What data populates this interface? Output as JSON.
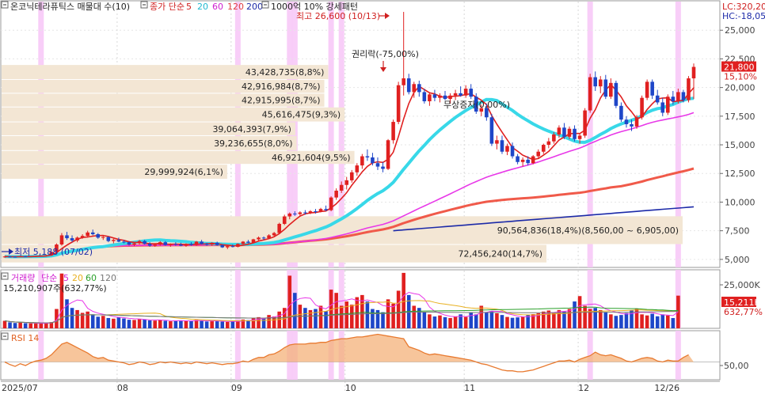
{
  "price_panel": {
    "title": "온코닉테라퓨틱스 매물대 수(10)",
    "ma_prefix": "종가 단순",
    "ma_periods": [
      "5",
      "20",
      "60",
      "120",
      "200"
    ],
    "ma_colors": [
      "#e02020",
      "#38d8e8",
      "#e838e8",
      "#f05a4a",
      "#1c2aa8"
    ],
    "pattern_label": "1000억 10% 강세패턴",
    "lc_label": "LC:320,20",
    "hc_label": "HC:-18,05",
    "high_label": "최고 26,600 (10/13)",
    "low_label": "최저 5,188 (07/02)",
    "rights_label": "권리락(-75,00%)",
    "bonus_label": "무상증자(0,00%)",
    "current_price": "21,800",
    "current_change": "15,10%",
    "y_ticks": [
      "25,000",
      "22,500",
      "20,000",
      "17,500",
      "15,000",
      "12,500",
      "10,000",
      "7,500",
      "5,000"
    ]
  },
  "volume_panel": {
    "title": "거래량",
    "ma_prefix": "단순",
    "ma_periods": [
      "5",
      "20",
      "60",
      "120"
    ],
    "ma_colors": [
      "#e838e8",
      "#e8b020",
      "#2aa02a",
      "#777777"
    ],
    "current_value": "15,210,907주(632,77%)",
    "axis_label": "25,000K",
    "tag_value": "15,211K",
    "tag_pct": "632,77%"
  },
  "rsi_panel": {
    "title": "RSI 14",
    "axis_label": "50,00"
  },
  "x_axis": {
    "labels": [
      "2025/07",
      "08",
      "09",
      "10",
      "11",
      "12",
      "12/26"
    ]
  },
  "chart_data": {
    "type": "candlestick",
    "title": "온코닉테라퓨틱스 매물대 수(10)",
    "ylim": [
      4300,
      27500
    ],
    "volume_profile": [
      {
        "price_low": 20700,
        "price_high": 22000,
        "volume": "43,428,735",
        "pct": "8,8%"
      },
      {
        "price_low": 19500,
        "price_high": 20700,
        "volume": "42,916,984",
        "pct": "8,7%"
      },
      {
        "price_low": 18300,
        "price_high": 19500,
        "volume": "42,915,995",
        "pct": "8,7%"
      },
      {
        "price_low": 17000,
        "price_high": 18300,
        "volume": "45,616,475",
        "pct": "9,3%"
      },
      {
        "price_low": 15800,
        "price_high": 17000,
        "volume": "39,064,393",
        "pct": "7,9%"
      },
      {
        "price_low": 14500,
        "price_high": 15800,
        "volume": "39,236,655",
        "pct": "8,0%"
      },
      {
        "price_low": 13300,
        "price_high": 14500,
        "volume": "46,921,604",
        "pct": "9,5%"
      },
      {
        "price_low": 12000,
        "price_high": 13300,
        "volume": "29,999,924",
        "pct": "6,1%"
      },
      {
        "price_low": 6300,
        "price_high": 8800,
        "volume": "90,564,836",
        "pct": "18,4%",
        "range": "8,560,00 ~ 6,905,00"
      },
      {
        "price_low": 4700,
        "price_high": 6300,
        "volume": "72,456,240",
        "pct": "14,7%"
      }
    ],
    "candles": [
      [
        5200,
        5300,
        5150,
        5250
      ],
      [
        5250,
        5300,
        5188,
        5230
      ],
      [
        5230,
        5280,
        5190,
        5210
      ],
      [
        5210,
        5300,
        5200,
        5280
      ],
      [
        5280,
        5310,
        5200,
        5240
      ],
      [
        5240,
        5280,
        5200,
        5260
      ],
      [
        5260,
        5320,
        5220,
        5300
      ],
      [
        5300,
        5350,
        5250,
        5320
      ],
      [
        5320,
        5400,
        5280,
        5350
      ],
      [
        5350,
        5700,
        5300,
        5650
      ],
      [
        5650,
        6400,
        5600,
        6300
      ],
      [
        6300,
        7300,
        6200,
        7100
      ],
      [
        7100,
        7400,
        6700,
        6850
      ],
      [
        6850,
        7100,
        6500,
        6650
      ],
      [
        6650,
        7000,
        6500,
        6900
      ],
      [
        6900,
        7200,
        6800,
        7050
      ],
      [
        7050,
        7500,
        6900,
        7350
      ],
      [
        7350,
        7600,
        7100,
        7200
      ],
      [
        7200,
        7300,
        6800,
        6900
      ],
      [
        6900,
        7100,
        6700,
        6950
      ],
      [
        6950,
        7000,
        6500,
        6600
      ],
      [
        6600,
        6800,
        6400,
        6700
      ],
      [
        6700,
        6900,
        6500,
        6550
      ],
      [
        6550,
        6700,
        6400,
        6500
      ],
      [
        6500,
        6600,
        6200,
        6300
      ],
      [
        6300,
        6500,
        6150,
        6400
      ],
      [
        6400,
        6700,
        6300,
        6600
      ],
      [
        6600,
        6700,
        6300,
        6350
      ],
      [
        6350,
        6500,
        6100,
        6200
      ],
      [
        6200,
        6400,
        6100,
        6300
      ],
      [
        6300,
        6600,
        6200,
        6500
      ],
      [
        6500,
        6600,
        6200,
        6250
      ],
      [
        6250,
        6400,
        6100,
        6350
      ],
      [
        6350,
        6500,
        6200,
        6300
      ],
      [
        6300,
        6450,
        6150,
        6200
      ],
      [
        6200,
        6400,
        6100,
        6350
      ],
      [
        6350,
        6500,
        6200,
        6250
      ],
      [
        6250,
        6600,
        6200,
        6550
      ],
      [
        6550,
        6700,
        6300,
        6350
      ],
      [
        6350,
        6450,
        6200,
        6300
      ],
      [
        6300,
        6500,
        6200,
        6450
      ],
      [
        6450,
        6550,
        6200,
        6250
      ],
      [
        6250,
        6300,
        6000,
        6050
      ],
      [
        6050,
        6200,
        5900,
        6150
      ],
      [
        6150,
        6300,
        6050,
        6100
      ],
      [
        6100,
        6400,
        6050,
        6350
      ],
      [
        6350,
        6600,
        6300,
        6550
      ],
      [
        6550,
        6700,
        6400,
        6450
      ],
      [
        6450,
        6800,
        6400,
        6750
      ],
      [
        6750,
        7000,
        6650,
        6900
      ],
      [
        6900,
        7000,
        6700,
        6850
      ],
      [
        6850,
        7200,
        6800,
        7100
      ],
      [
        7100,
        7400,
        7000,
        7300
      ],
      [
        7300,
        8200,
        7200,
        8100
      ],
      [
        8100,
        8900,
        8000,
        8750
      ],
      [
        8750,
        9100,
        8500,
        9000
      ],
      [
        9000,
        9200,
        8800,
        8950
      ],
      [
        8950,
        9200,
        8800,
        9100
      ],
      [
        9100,
        9300,
        8900,
        9050
      ],
      [
        9050,
        9300,
        8950,
        9200
      ],
      [
        9200,
        9400,
        9000,
        9150
      ],
      [
        9150,
        9500,
        9100,
        9400
      ],
      [
        9400,
        9700,
        9200,
        9300
      ],
      [
        9300,
        10500,
        9200,
        10400
      ],
      [
        10400,
        11200,
        10200,
        11000
      ],
      [
        11000,
        11800,
        10800,
        11500
      ],
      [
        11500,
        12200,
        11100,
        11900
      ],
      [
        11900,
        12800,
        11700,
        12600
      ],
      [
        12600,
        13400,
        12300,
        13200
      ],
      [
        13200,
        14200,
        12900,
        14000
      ],
      [
        14000,
        14600,
        13600,
        13900
      ],
      [
        13900,
        14300,
        13200,
        13400
      ],
      [
        13400,
        13900,
        12800,
        13100
      ],
      [
        13100,
        13500,
        12600,
        12900
      ],
      [
        12900,
        15500,
        12800,
        15400
      ],
      [
        15400,
        17200,
        15100,
        17000
      ],
      [
        17000,
        20500,
        16800,
        20200
      ],
      [
        20200,
        26600,
        19300,
        20800
      ],
      [
        20800,
        21200,
        19400,
        19600
      ],
      [
        19600,
        20500,
        19100,
        20300
      ],
      [
        20300,
        20600,
        19200,
        19600
      ],
      [
        19600,
        19900,
        18600,
        18800
      ],
      [
        18800,
        19600,
        18400,
        19400
      ],
      [
        19400,
        19800,
        18800,
        19100
      ],
      [
        19100,
        19500,
        18700,
        19300
      ],
      [
        19300,
        19700,
        18900,
        19000
      ],
      [
        19000,
        19500,
        18600,
        19300
      ],
      [
        19300,
        19800,
        18900,
        19500
      ],
      [
        19500,
        20100,
        19200,
        19300
      ],
      [
        19300,
        20200,
        19100,
        19900
      ],
      [
        19900,
        20300,
        19000,
        19200
      ],
      [
        19200,
        19500,
        17700,
        17900
      ],
      [
        17900,
        18500,
        17500,
        18200
      ],
      [
        18200,
        18600,
        17100,
        17400
      ],
      [
        17400,
        17700,
        14900,
        15100
      ],
      [
        15100,
        15800,
        14600,
        15400
      ],
      [
        15400,
        15800,
        14200,
        14400
      ],
      [
        14400,
        15100,
        14100,
        14900
      ],
      [
        14900,
        15200,
        13800,
        14000
      ],
      [
        14000,
        14200,
        13300,
        13500
      ],
      [
        13500,
        13900,
        13100,
        13700
      ],
      [
        13700,
        14000,
        13200,
        13400
      ],
      [
        13400,
        14100,
        13300,
        14000
      ],
      [
        14000,
        14600,
        13800,
        14400
      ],
      [
        14400,
        15100,
        14200,
        15000
      ],
      [
        15000,
        15600,
        14700,
        15300
      ],
      [
        15300,
        16100,
        15100,
        15900
      ],
      [
        15900,
        16700,
        15600,
        16500
      ],
      [
        16500,
        16900,
        15500,
        15700
      ],
      [
        15700,
        16600,
        15500,
        16400
      ],
      [
        16400,
        16700,
        15300,
        15500
      ],
      [
        15500,
        16000,
        15100,
        15800
      ],
      [
        15800,
        18200,
        15600,
        18000
      ],
      [
        18000,
        21200,
        17800,
        20900
      ],
      [
        20900,
        21400,
        19700,
        20100
      ],
      [
        20100,
        21000,
        19500,
        20700
      ],
      [
        20700,
        21100,
        19000,
        19200
      ],
      [
        19200,
        20800,
        19000,
        20400
      ],
      [
        20400,
        20600,
        18200,
        18400
      ],
      [
        18400,
        18700,
        17000,
        17200
      ],
      [
        17200,
        17500,
        16500,
        16800
      ],
      [
        16800,
        17200,
        16200,
        16600
      ],
      [
        16600,
        17600,
        16400,
        17400
      ],
      [
        17400,
        19300,
        17200,
        19100
      ],
      [
        19100,
        20700,
        18900,
        20500
      ],
      [
        20500,
        20700,
        19000,
        19300
      ],
      [
        19300,
        19800,
        18500,
        18700
      ],
      [
        18700,
        19100,
        17500,
        17800
      ],
      [
        17800,
        19400,
        17600,
        19200
      ],
      [
        19200,
        19700,
        18500,
        18800
      ],
      [
        18800,
        19900,
        18600,
        19600
      ],
      [
        19600,
        19800,
        18700,
        18900
      ],
      [
        18900,
        21000,
        18700,
        20800
      ],
      [
        20800,
        22100,
        19000,
        21800
      ]
    ],
    "volume_k": [
      3500,
      2800,
      2500,
      2600,
      2400,
      2300,
      2200,
      2300,
      2600,
      2900,
      9000,
      25500,
      13500,
      9500,
      8500,
      7200,
      7800,
      6500,
      5400,
      5800,
      4800,
      4500,
      5200,
      4600,
      4000,
      3900,
      4200,
      4100,
      3700,
      3600,
      3900,
      3500,
      3300,
      3400,
      3700,
      3600,
      3300,
      3900,
      3500,
      3200,
      3400,
      3300,
      3100,
      3000,
      3200,
      3500,
      4100,
      3800,
      4700,
      5200,
      4800,
      6200,
      5500,
      7800,
      9500,
      24500,
      16500,
      11000,
      9500,
      8500,
      9000,
      10500,
      8000,
      18000,
      16500,
      10500,
      12500,
      11000,
      14500,
      15500,
      12500,
      9000,
      8500,
      7500,
      13500,
      11500,
      17500,
      25800,
      15500,
      10500,
      9500,
      7500,
      6500,
      5500,
      6000,
      5200,
      4800,
      5500,
      6500,
      5300,
      7500,
      6500,
      10500,
      7500,
      8000,
      7000,
      6200,
      5300,
      4900,
      5100,
      5400,
      6100,
      6600,
      7000,
      7800,
      8300,
      7100,
      8500,
      7800,
      9000,
      12500,
      15000,
      10500,
      9000,
      9500,
      8500,
      7500,
      6500,
      5800,
      6200,
      7100,
      8400,
      9000,
      6500,
      6000,
      6800,
      5600,
      6500,
      6000,
      4800,
      15211
    ],
    "rsi": [
      50,
      47,
      45,
      48,
      46,
      49,
      51,
      52,
      54,
      58,
      64,
      70,
      72,
      69,
      66,
      63,
      60,
      56,
      54,
      55,
      52,
      51,
      50,
      49,
      47,
      48,
      50,
      49,
      47,
      48,
      50,
      49,
      50,
      49,
      48,
      49,
      48,
      50,
      49,
      48,
      49,
      48,
      47,
      48,
      48,
      49,
      51,
      50,
      53,
      55,
      55,
      58,
      59,
      62,
      66,
      69,
      70,
      70,
      70,
      71,
      71,
      72,
      72,
      74,
      75,
      76,
      76,
      77,
      78,
      78,
      79,
      80,
      81,
      80,
      79,
      78,
      77,
      76,
      67,
      65,
      63,
      60,
      58,
      59,
      58,
      57,
      56,
      55,
      54,
      53,
      52,
      50,
      48,
      47,
      45,
      43,
      41,
      40,
      40,
      39,
      39,
      40,
      41,
      43,
      45,
      47,
      49,
      51,
      51,
      52,
      50,
      53,
      55,
      57,
      61,
      58,
      57,
      58,
      56,
      54,
      51,
      50,
      52,
      54,
      55,
      54,
      51,
      50,
      52,
      51,
      51,
      55,
      58
    ],
    "highlights": [
      7,
      45,
      55,
      56,
      63,
      65,
      113,
      130
    ],
    "x_label_indices": [
      0,
      22,
      44,
      66,
      89,
      111,
      130
    ]
  }
}
